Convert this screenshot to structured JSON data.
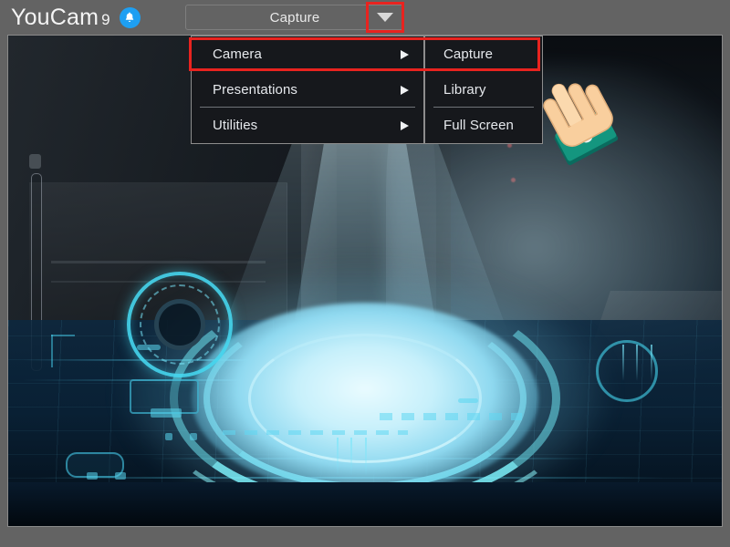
{
  "app": {
    "brand_name": "YouCam",
    "brand_version": "9",
    "notification_icon": "bell-icon"
  },
  "toolbar": {
    "mode_button_label": "Capture",
    "dropdown_icon": "chevron-down-icon",
    "dropdown_highlighted": true,
    "highlight_color": "#e8231f"
  },
  "menu": {
    "main_items": [
      {
        "label": "Camera",
        "has_submenu": true,
        "submenu_icon": "chevron-right-icon",
        "highlighted": true,
        "separator_below": false
      },
      {
        "label": "Presentations",
        "has_submenu": true,
        "submenu_icon": "chevron-right-icon",
        "highlighted": false,
        "separator_below": true
      },
      {
        "label": "Utilities",
        "has_submenu": true,
        "submenu_icon": "chevron-right-icon",
        "highlighted": false,
        "separator_below": false
      }
    ],
    "submenu_items": [
      {
        "label": "Capture",
        "highlighted": true,
        "separator_below": false
      },
      {
        "label": "Library",
        "highlighted": false,
        "separator_below": true
      },
      {
        "label": "Full Screen",
        "highlighted": false,
        "separator_below": false
      }
    ],
    "background_color": "#16181c",
    "border_color": "#8d8d8d",
    "text_color": "#e6e9ed"
  },
  "cursor": {
    "type": "pointing-hand-cursor",
    "skin_color": "#f6c89a",
    "sleeve_color": "#0f8a7a"
  },
  "preview": {
    "description": "sci-fi tech hangar background with glowing cyan platform",
    "frame_color": "#8a8a8a"
  }
}
